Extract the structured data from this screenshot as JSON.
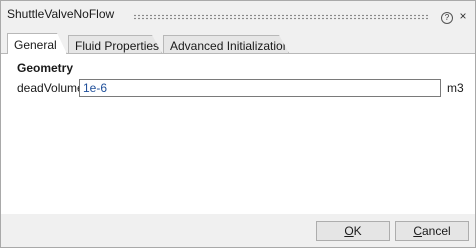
{
  "window": {
    "title": "ShuttleValveNoFlow",
    "help_icon": "?",
    "close_icon": "×"
  },
  "tabs": [
    {
      "label": "General",
      "active": true
    },
    {
      "label": "Fluid Properties",
      "active": false
    },
    {
      "label": "Advanced Initialization",
      "active": false
    }
  ],
  "general": {
    "section_title": "Geometry",
    "fields": [
      {
        "label": "deadVolume",
        "value": "1e-6",
        "unit": "m3"
      }
    ]
  },
  "buttons": {
    "ok": {
      "mnemonic": "O",
      "rest": "K"
    },
    "cancel": {
      "mnemonic": "C",
      "rest": "ancel"
    }
  }
}
